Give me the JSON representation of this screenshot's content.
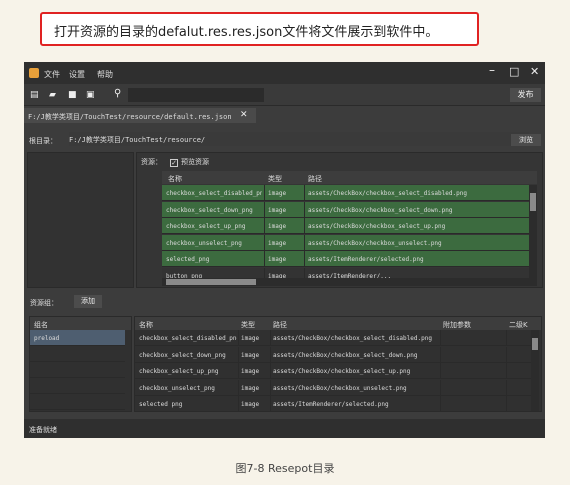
{
  "callout_text": "打开资源的目录的defalut.res.res.json文件将文件展示到软件中。",
  "app": {
    "menu": [
      "文件",
      "设置",
      "帮助"
    ],
    "window_controls": [
      "minimize-icon",
      "maximize-icon",
      "close-icon"
    ],
    "toolbar": {
      "icons": [
        "new-file-icon",
        "open-folder-icon",
        "save-icon",
        "save-all-icon"
      ],
      "search_icon": "search-icon",
      "search_value": "",
      "publish_label": "发布"
    },
    "tab": {
      "label": "F:/J教学类项目/TouchTest/resource/default.res.json",
      "close_icon": "close-icon"
    },
    "root": {
      "label": "根目录：",
      "path": "F:/J教学类项目/TouchTest/resource/",
      "browse_label": "浏览"
    },
    "resources": {
      "title": "资源：",
      "preview_checked": true,
      "preview_label": "预览资源",
      "columns": [
        "名称",
        "类型",
        "路径"
      ],
      "rows": [
        {
          "name": "checkbox_select_disabled_png",
          "type": "image",
          "path": "assets/CheckBox/checkbox_select_disabled.png"
        },
        {
          "name": "checkbox_select_down_png",
          "type": "image",
          "path": "assets/CheckBox/checkbox_select_down.png"
        },
        {
          "name": "checkbox_select_up_png",
          "type": "image",
          "path": "assets/CheckBox/checkbox_select_up.png"
        },
        {
          "name": "checkbox_unselect_png",
          "type": "image",
          "path": "assets/CheckBox/checkbox_unselect.png"
        },
        {
          "name": "selected_png",
          "type": "image",
          "path": "assets/ItemRenderer/selected.png"
        },
        {
          "name": "button_png",
          "type": "image",
          "path": "assets/ItemRenderer/..."
        }
      ],
      "row_color": "#3c6b3f"
    },
    "groups": {
      "label": "资源组：",
      "add_label": "添加",
      "columns": [
        "组名"
      ],
      "rows": [
        "preload"
      ],
      "selected_color": "#4e5e70"
    },
    "group_detail": {
      "columns": [
        "名称",
        "类型",
        "路径",
        "附加参数",
        "二级K"
      ],
      "rows": [
        {
          "name": "checkbox_select_disabled_png",
          "type": "image",
          "path": "assets/CheckBox/checkbox_select_disabled.png",
          "extra": ""
        },
        {
          "name": "checkbox_select_down_png",
          "type": "image",
          "path": "assets/CheckBox/checkbox_select_down.png",
          "extra": ""
        },
        {
          "name": "checkbox_select_up_png",
          "type": "image",
          "path": "assets/CheckBox/checkbox_select_up.png",
          "extra": ""
        },
        {
          "name": "checkbox_unselect_png",
          "type": "image",
          "path": "assets/CheckBox/checkbox_unselect.png",
          "extra": ""
        },
        {
          "name": "selected png",
          "type": "image",
          "path": "assets/ItemRenderer/selected.png",
          "extra": ""
        }
      ]
    },
    "status": "准备就绪"
  },
  "caption": "图7-8 Resepot目录"
}
